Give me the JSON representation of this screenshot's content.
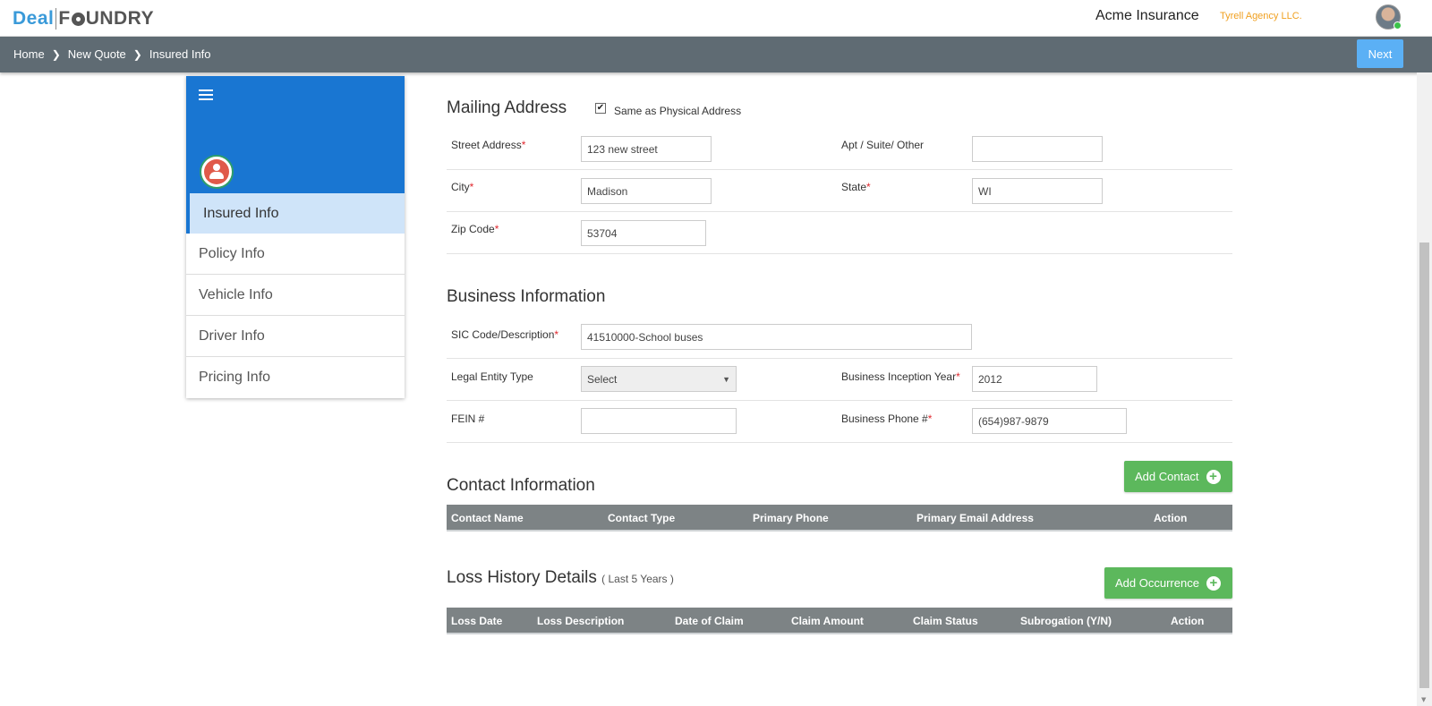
{
  "header": {
    "logo_left": "Deal",
    "logo_right_1": "F",
    "logo_right_2": "UNDRY",
    "company": "Acme Insurance",
    "agency": "Tyrell Agency LLC."
  },
  "breadcrumb": [
    "Home",
    "New Quote",
    "Insured Info"
  ],
  "next_label": "Next",
  "sidebar": {
    "items": [
      {
        "label": "Insured Info",
        "active": true
      },
      {
        "label": "Policy Info"
      },
      {
        "label": "Vehicle Info"
      },
      {
        "label": "Driver Info"
      },
      {
        "label": "Pricing Info"
      }
    ]
  },
  "mailing": {
    "title": "Mailing Address",
    "same_as_label": "Same as Physical Address",
    "same_as_checked": true,
    "street_label": "Street Address",
    "street_value": "123 new street",
    "apt_label": "Apt / Suite/ Other",
    "apt_value": "",
    "city_label": "City",
    "city_value": "Madison",
    "state_label": "State",
    "state_value": "WI",
    "zip_label": "Zip Code",
    "zip_value": "53704"
  },
  "business": {
    "title": "Business Information",
    "sic_label": "SIC Code/Description",
    "sic_value": "41510000-School buses",
    "entity_label": "Legal Entity Type",
    "entity_value": "Select",
    "inception_label": "Business Inception Year",
    "inception_value": "2012",
    "fein_label": "FEIN #",
    "fein_value": "",
    "phone_label": "Business Phone #",
    "phone_value": "(654)987-9879"
  },
  "contact": {
    "title": "Contact Information",
    "add_label": "Add Contact",
    "columns": [
      "Contact Name",
      "Contact Type",
      "Primary Phone",
      "Primary Email Address",
      "Action"
    ]
  },
  "loss": {
    "title": "Loss History Details",
    "subtitle": "( Last 5 Years )",
    "add_label": "Add Occurrence",
    "columns": [
      "Loss Date",
      "Loss Description",
      "Date of Claim",
      "Claim Amount",
      "Claim Status",
      "Subrogation (Y/N)",
      "Action"
    ]
  },
  "colors": {
    "brand_blue": "#1976d2",
    "crumb_bar": "#5f6b73",
    "green_button": "#5cb85c",
    "next_button": "#5bb0f5",
    "required": "#e0282e",
    "agency_text": "#f0a020"
  },
  "icons": {
    "menu": "hamburger-icon",
    "group": "group-users-icon",
    "crumb_separator": "chevron-right-icon",
    "add": "plus-circle-icon"
  }
}
